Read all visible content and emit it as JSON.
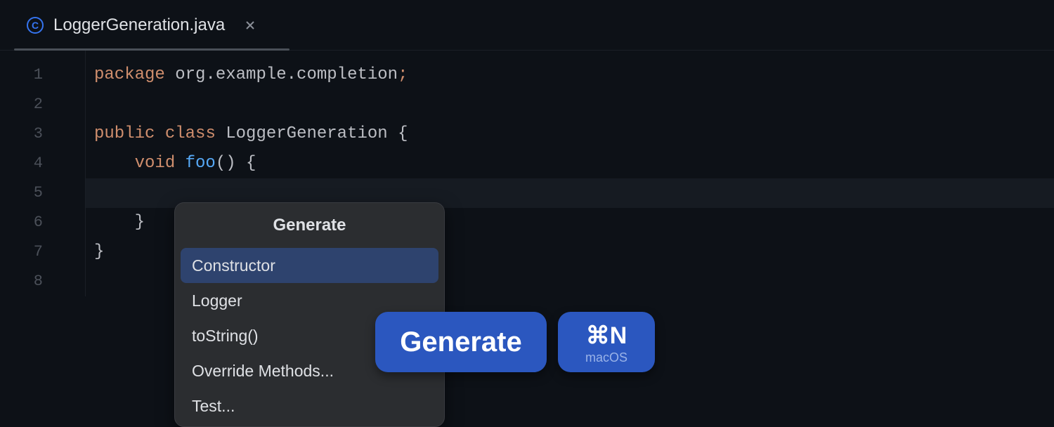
{
  "tab": {
    "file_icon_letter": "C",
    "file_name": "LoggerGeneration.java"
  },
  "editor": {
    "line_numbers": [
      "1",
      "2",
      "3",
      "4",
      "5",
      "6",
      "7",
      "8"
    ],
    "code": {
      "l1": {
        "kw": "package",
        "rest": " org.example.completion",
        "semi": ";"
      },
      "l3": {
        "kw1": "public",
        "kw2": "class",
        "cls": "LoggerGeneration",
        "brace": " {"
      },
      "l4": {
        "kw": "void",
        "method": "foo",
        "parens_brace": "() {"
      },
      "l6": {
        "brace": "}"
      },
      "l7": {
        "brace": "}"
      }
    }
  },
  "popup": {
    "title": "Generate",
    "items": [
      "Constructor",
      "Logger",
      "toString()",
      "Override Methods...",
      "Test..."
    ],
    "selected_index": 0
  },
  "badges": {
    "generate": "Generate",
    "shortcut_key": "⌘N",
    "shortcut_sub": "macOS"
  }
}
